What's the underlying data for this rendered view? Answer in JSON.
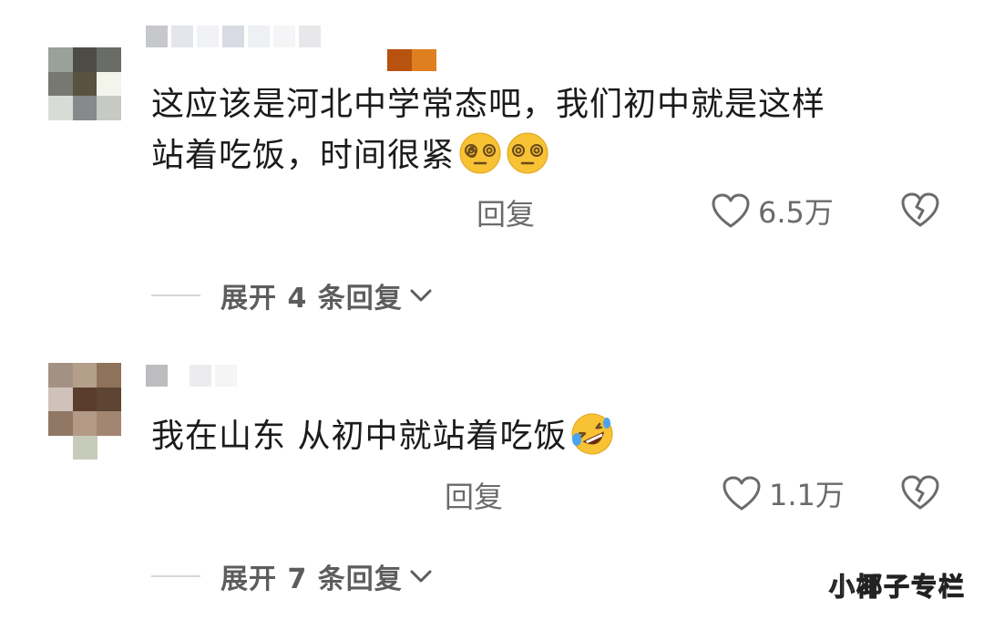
{
  "comments": [
    {
      "text": "这应该是河北中学常态吧，我们初中就是这样",
      "text_line2": "站着吃饭，时间很紧",
      "emojis": [
        "dizzy-face-icon",
        "dizzy-face-icon"
      ],
      "reply_label": "回复",
      "like_count": "6.5万",
      "expand_label": "展开 4 条回复"
    },
    {
      "text": "我在山东 从初中就站着吃饭",
      "emojis": [
        "rolling-laughing-icon"
      ],
      "reply_label": "回复",
      "like_count": "1.1万",
      "expand_label": "展开 7 条回复"
    }
  ],
  "watermark": "小椰子专栏",
  "colors": {
    "text": "#1b1b1b",
    "muted": "#6b6b6b",
    "emoji_yellow": "#f7c234"
  }
}
